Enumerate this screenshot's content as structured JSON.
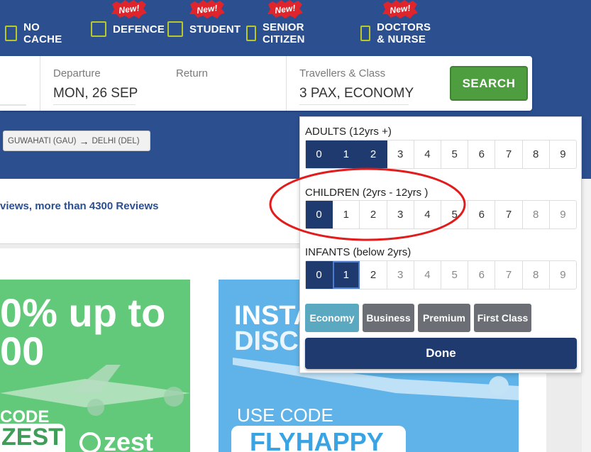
{
  "fare_options": [
    {
      "label": "NO CACHE",
      "badge": ""
    },
    {
      "label": "DEFENCE",
      "badge": "New!"
    },
    {
      "label": "STUDENT",
      "badge": "New!"
    },
    {
      "label": "SENIOR CITIZEN",
      "badge": "New!"
    },
    {
      "label": "DOCTORS & NURSE",
      "badge": "New!"
    }
  ],
  "search": {
    "departure_label": "Departure",
    "departure_value": "MON, 26 SEP",
    "return_label": "Return",
    "travellers_label": "Travellers & Class",
    "travellers_value": "3 PAX, ECONOMY",
    "search_button": "SEARCH"
  },
  "route": {
    "from": "GUWAHATI (GAU)",
    "to": "DELHI (DEL)"
  },
  "reviews_text": "views, more than 4300 Reviews",
  "pax_panel": {
    "adults_title": "ADULTS (12yrs +)",
    "children_title": "CHILDREN (2yrs - 12yrs )",
    "infants_title": "INFANTS (below 2yrs)",
    "numbers": [
      "0",
      "1",
      "2",
      "3",
      "4",
      "5",
      "6",
      "7",
      "8",
      "9"
    ],
    "adults_selected": 2,
    "children_selected": 0,
    "infants_selected": 1,
    "classes": [
      "Economy",
      "Business",
      "Premium",
      "First Class"
    ],
    "active_class": "Economy",
    "done_button": "Done"
  },
  "banners": {
    "green_line1": "0% up to",
    "green_line2": "00",
    "green_code_label": "CODE",
    "green_code": "ZEST",
    "green_logo": "zest",
    "blue_line1": "INSTA",
    "blue_line2": "DISCO",
    "blue_use_code": "USE CODE",
    "blue_code": "FLYHAPPY"
  },
  "colors": {
    "header": "#2b4f8f",
    "navy": "#1e3a6e",
    "search_green": "#4e9d3e",
    "annotation": "#e21b1b"
  }
}
